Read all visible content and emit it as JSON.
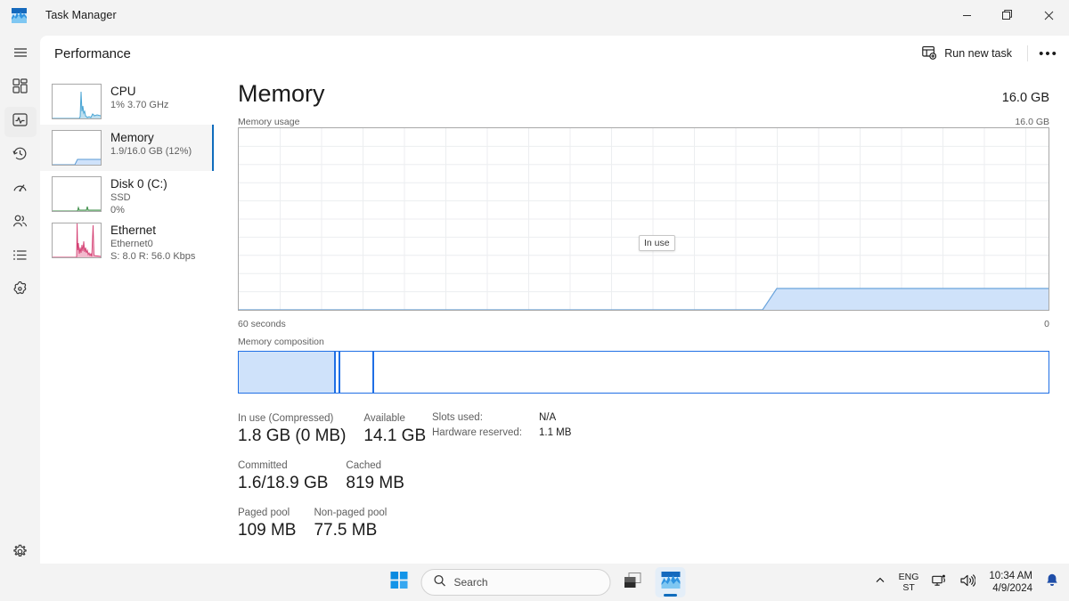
{
  "window": {
    "title": "Task Manager",
    "app_icon": "task-manager-icon",
    "controls": {
      "minimize": "—",
      "maximize": "❐",
      "close": "✕"
    }
  },
  "rail": {
    "items": [
      {
        "name": "hamburger",
        "icon": "hamburger-icon"
      },
      {
        "name": "processes",
        "icon": "processes-grid-icon"
      },
      {
        "name": "performance",
        "icon": "performance-pulse-icon",
        "selected": true
      },
      {
        "name": "app-history",
        "icon": "history-clock-icon"
      },
      {
        "name": "startup-apps",
        "icon": "gauge-icon"
      },
      {
        "name": "users",
        "icon": "people-icon"
      },
      {
        "name": "details",
        "icon": "list-icon"
      },
      {
        "name": "services",
        "icon": "services-gear-icon"
      }
    ],
    "settings": {
      "name": "settings",
      "icon": "settings-gear-icon"
    }
  },
  "header": {
    "page_title": "Performance",
    "run_new_task": "Run new task",
    "run_new_task_icon": "window-plus-icon",
    "more_options": "•••"
  },
  "resources": [
    {
      "name": "CPU",
      "sub1": "1%  3.70 GHz",
      "sub2": "",
      "color": "#4aa5d4",
      "selected": false
    },
    {
      "name": "Memory",
      "sub1": "1.9/16.0 GB (12%)",
      "sub2": "",
      "color": "#7ab2e8",
      "selected": true
    },
    {
      "name": "Disk 0 (C:)",
      "sub1": "SSD",
      "sub2": "0%",
      "color": "#3f8f4a",
      "selected": false
    },
    {
      "name": "Ethernet",
      "sub1": "Ethernet0",
      "sub2": "S: 8.0 R: 56.0 Kbps",
      "color": "#d43f72",
      "selected": false
    }
  ],
  "main": {
    "title": "Memory",
    "total": "16.0 GB",
    "usage_label": "Memory usage",
    "usage_max": "16.0 GB",
    "time_label": "60 seconds",
    "axis_min": "0",
    "tooltip": "In use",
    "composition_label": "Memory composition"
  },
  "chart_data": {
    "type": "area",
    "title": "Memory usage",
    "xlabel": "60 seconds",
    "ylabel": "16.0 GB",
    "ylim": [
      0,
      16.0
    ],
    "xlim": [
      0,
      60
    ],
    "grid": true,
    "series": [
      {
        "name": "In use",
        "fill_color": "#cfe2fa",
        "line_color": "#5b9bd5",
        "points": [
          {
            "t": 0,
            "gb": 0
          },
          {
            "t": 36,
            "gb": 0
          },
          {
            "t": 39,
            "gb": 1.9
          },
          {
            "t": 60,
            "gb": 1.9
          }
        ]
      }
    ],
    "composition": {
      "type": "bar",
      "total_gb": 16.0,
      "segments": [
        {
          "name": "In use",
          "gb": 1.8,
          "width_pct": 11.8,
          "filled": true
        },
        {
          "name": "Modified",
          "gb": 0.05,
          "width_pct": 0.3,
          "filled": false
        },
        {
          "name": "Standby",
          "gb": 0.82,
          "width_pct": 4.4,
          "filled": false
        },
        {
          "name": "Free",
          "gb": 13.3,
          "width_pct": 83.5,
          "filled": false
        }
      ]
    }
  },
  "stats": {
    "row1": [
      {
        "label": "In use (Compressed)",
        "value": "1.8 GB (0 MB)"
      },
      {
        "label": "Available",
        "value": "14.1 GB"
      }
    ],
    "row2": [
      {
        "label": "Committed",
        "value": "1.6/18.9 GB"
      },
      {
        "label": "Cached",
        "value": "819 MB"
      }
    ],
    "row3": [
      {
        "label": "Paged pool",
        "value": "109 MB"
      },
      {
        "label": "Non-paged pool",
        "value": "77.5 MB"
      }
    ],
    "side": [
      {
        "key": "Slots used:",
        "value": "N/A"
      },
      {
        "key": "Hardware reserved:",
        "value": "1.1 MB"
      }
    ]
  },
  "taskbar": {
    "start": "start-icon",
    "search_placeholder": "Search",
    "search_icon": "search-icon",
    "task_view": "task-view-icon",
    "task_manager": "task-manager-icon",
    "tray": {
      "chevron": "chevron-up-icon",
      "lang_top": "ENG",
      "lang_bottom": "ST",
      "network_icon": "network-icon",
      "volume_icon": "volume-icon",
      "time": "10:34 AM",
      "date": "4/9/2024",
      "bell_icon": "notification-bell-icon"
    }
  }
}
